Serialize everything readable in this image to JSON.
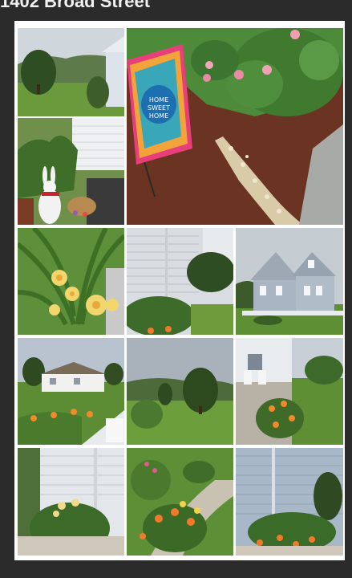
{
  "page": {
    "title": "1402 Broad Street"
  },
  "gallery": {
    "sign_text": "HOME SWEET HOME",
    "photos": [
      {
        "id": "house-lawn"
      },
      {
        "id": "bunny-porch"
      },
      {
        "id": "garden-sign"
      },
      {
        "id": "daylily-closeup"
      },
      {
        "id": "siding-shrubs"
      },
      {
        "id": "blue-house"
      },
      {
        "id": "white-house-lawn"
      },
      {
        "id": "trees-hills"
      },
      {
        "id": "porch-chairs"
      },
      {
        "id": "house-corner-lilies"
      },
      {
        "id": "flower-path"
      },
      {
        "id": "siding-flowerbed"
      }
    ]
  }
}
